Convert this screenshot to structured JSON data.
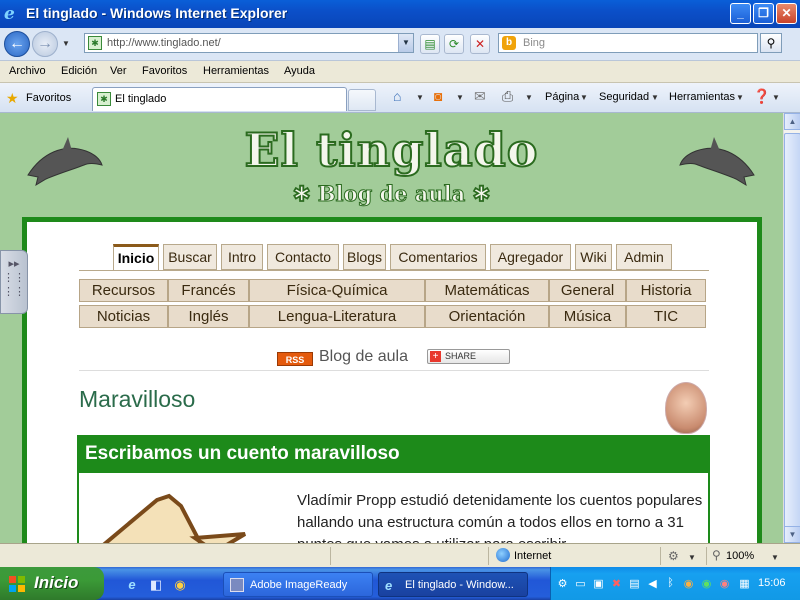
{
  "window": {
    "title": "El tinglado - Windows Internet Explorer"
  },
  "address": {
    "url": "http://www.tinglado.net/",
    "search_placeholder": "Bing"
  },
  "menu": [
    "Archivo",
    "Edición",
    "Ver",
    "Favoritos",
    "Herramientas",
    "Ayuda"
  ],
  "favorites_bar": {
    "favorites_label": "Favoritos",
    "tab_title": "El tinglado",
    "commands": {
      "page": "Página",
      "security": "Seguridad",
      "tools": "Herramientas"
    }
  },
  "site": {
    "title": "El tinglado",
    "subtitle": "✱ Blog de aula ✱",
    "nav_tabs": [
      "Inicio",
      "Buscar",
      "Intro",
      "Contacto",
      "Blogs",
      "Comentarios",
      "Agregador",
      "Wiki",
      "Admin"
    ],
    "active_tab": "Inicio",
    "categories_row1": [
      "Recursos",
      "Francés",
      "Física-Química",
      "Matemáticas",
      "General",
      "Historia"
    ],
    "categories_row2": [
      "Noticias",
      "Inglés",
      "Lengua-Literatura",
      "Orientación",
      "Música",
      "TIC"
    ],
    "rss_label": "RSS",
    "blog_label": "Blog de aula",
    "share_label": "SHARE",
    "page_title": "Maravilloso",
    "post": {
      "heading": "Escribamos un cuento maravilloso",
      "text": "Vladímir Propp estudió detenidamente los cuentos populares hallando una estructura común a todos ellos en torno a 31 puntos que vamos a utilizar para escribir"
    }
  },
  "status": {
    "zone": "Internet",
    "zoom": "100%"
  },
  "taskbar": {
    "start": "Inicio",
    "tasks": [
      "Adobe ImageReady",
      "El tinglado - Window..."
    ],
    "clock": "15:06"
  },
  "colors": {
    "site_green": "#1d8a1a",
    "page_bg": "#a2cc99",
    "taskbar_blue": "#245edb",
    "start_green": "#3b9a37"
  }
}
